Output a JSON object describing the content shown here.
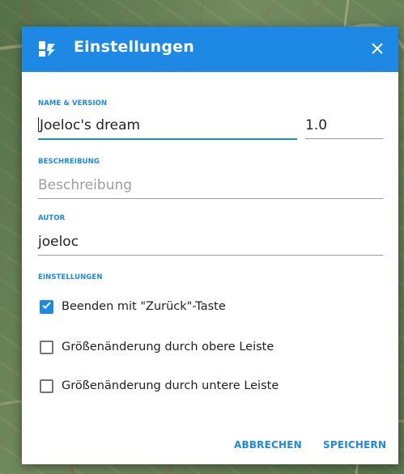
{
  "dialog": {
    "title": "Einstellungen",
    "header_icon": "dashboard-icon",
    "close_icon": "close-icon"
  },
  "sections": {
    "name_version": {
      "label": "NAME & VERSION",
      "name_value": "Joeloc's dream",
      "version_value": "1.0"
    },
    "description": {
      "label": "BESCHREIBUNG",
      "placeholder": "Beschreibung"
    },
    "author": {
      "label": "AUTOR",
      "value": "joeloc"
    },
    "settings": {
      "label": "EINSTELLUNGEN",
      "options": [
        {
          "label": "Beenden mit \"Zurück\"-Taste",
          "checked": true
        },
        {
          "label": "Größenänderung durch obere Leiste",
          "checked": false
        },
        {
          "label": "Größenänderung durch untere Leiste",
          "checked": false
        }
      ]
    }
  },
  "actions": {
    "cancel": "ABBRECHEN",
    "save": "SPEICHERN"
  },
  "colors": {
    "accent": "#1e88e5",
    "header_bg": "#1e88e5"
  }
}
